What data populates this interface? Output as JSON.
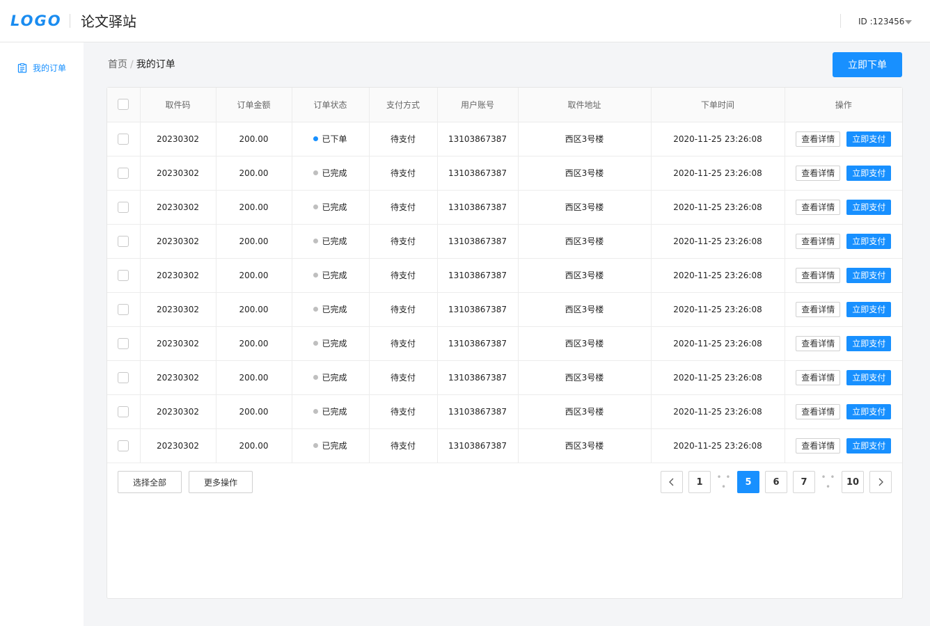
{
  "header": {
    "logo": "LOGO",
    "title": "论文驿站",
    "user_id": "ID :123456"
  },
  "sidebar": {
    "items": [
      {
        "label": "我的订单",
        "icon": "clipboard-list-icon"
      }
    ]
  },
  "breadcrumb": {
    "home": "首页",
    "separator": "/",
    "current": "我的订单"
  },
  "actions": {
    "order_now": "立即下单"
  },
  "table": {
    "columns": [
      "取件码",
      "订单金额",
      "订单状态",
      "支付方式",
      "用户账号",
      "取件地址",
      "下单时间",
      "操作"
    ],
    "rows": [
      {
        "code": "20230302",
        "amount": "200.00",
        "status": "已下单",
        "status_color": "#1890ff",
        "payment": "待支付",
        "account": "13103867387",
        "address": "西区3号楼",
        "time": "2020-11-25 23:26:08"
      },
      {
        "code": "20230302",
        "amount": "200.00",
        "status": "已完成",
        "status_color": "#bfbfbf",
        "payment": "待支付",
        "account": "13103867387",
        "address": "西区3号楼",
        "time": "2020-11-25 23:26:08"
      },
      {
        "code": "20230302",
        "amount": "200.00",
        "status": "已完成",
        "status_color": "#bfbfbf",
        "payment": "待支付",
        "account": "13103867387",
        "address": "西区3号楼",
        "time": "2020-11-25 23:26:08"
      },
      {
        "code": "20230302",
        "amount": "200.00",
        "status": "已完成",
        "status_color": "#bfbfbf",
        "payment": "待支付",
        "account": "13103867387",
        "address": "西区3号楼",
        "time": "2020-11-25 23:26:08"
      },
      {
        "code": "20230302",
        "amount": "200.00",
        "status": "已完成",
        "status_color": "#bfbfbf",
        "payment": "待支付",
        "account": "13103867387",
        "address": "西区3号楼",
        "time": "2020-11-25 23:26:08"
      },
      {
        "code": "20230302",
        "amount": "200.00",
        "status": "已完成",
        "status_color": "#bfbfbf",
        "payment": "待支付",
        "account": "13103867387",
        "address": "西区3号楼",
        "time": "2020-11-25 23:26:08"
      },
      {
        "code": "20230302",
        "amount": "200.00",
        "status": "已完成",
        "status_color": "#bfbfbf",
        "payment": "待支付",
        "account": "13103867387",
        "address": "西区3号楼",
        "time": "2020-11-25 23:26:08"
      },
      {
        "code": "20230302",
        "amount": "200.00",
        "status": "已完成",
        "status_color": "#bfbfbf",
        "payment": "待支付",
        "account": "13103867387",
        "address": "西区3号楼",
        "time": "2020-11-25 23:26:08"
      },
      {
        "code": "20230302",
        "amount": "200.00",
        "status": "已完成",
        "status_color": "#bfbfbf",
        "payment": "待支付",
        "account": "13103867387",
        "address": "西区3号楼",
        "time": "2020-11-25 23:26:08"
      },
      {
        "code": "20230302",
        "amount": "200.00",
        "status": "已完成",
        "status_color": "#bfbfbf",
        "payment": "待支付",
        "account": "13103867387",
        "address": "西区3号楼",
        "time": "2020-11-25 23:26:08"
      }
    ],
    "row_actions": {
      "detail": "查看详情",
      "pay": "立即支付"
    }
  },
  "footer": {
    "select_all": "选择全部",
    "more_actions": "更多操作"
  },
  "pagination": {
    "items": [
      {
        "type": "prev",
        "icon": "chevron-left-icon"
      },
      {
        "type": "page",
        "label": "1"
      },
      {
        "type": "ellipsis",
        "label": "• • •"
      },
      {
        "type": "page",
        "label": "5",
        "active": true
      },
      {
        "type": "page",
        "label": "6"
      },
      {
        "type": "page",
        "label": "7"
      },
      {
        "type": "ellipsis",
        "label": "• • •"
      },
      {
        "type": "page",
        "label": "10"
      },
      {
        "type": "next",
        "icon": "chevron-right-icon"
      }
    ]
  },
  "colors": {
    "primary": "#1890ff",
    "background": "#f4f5f7",
    "inactive_dot": "#bfbfbf"
  }
}
